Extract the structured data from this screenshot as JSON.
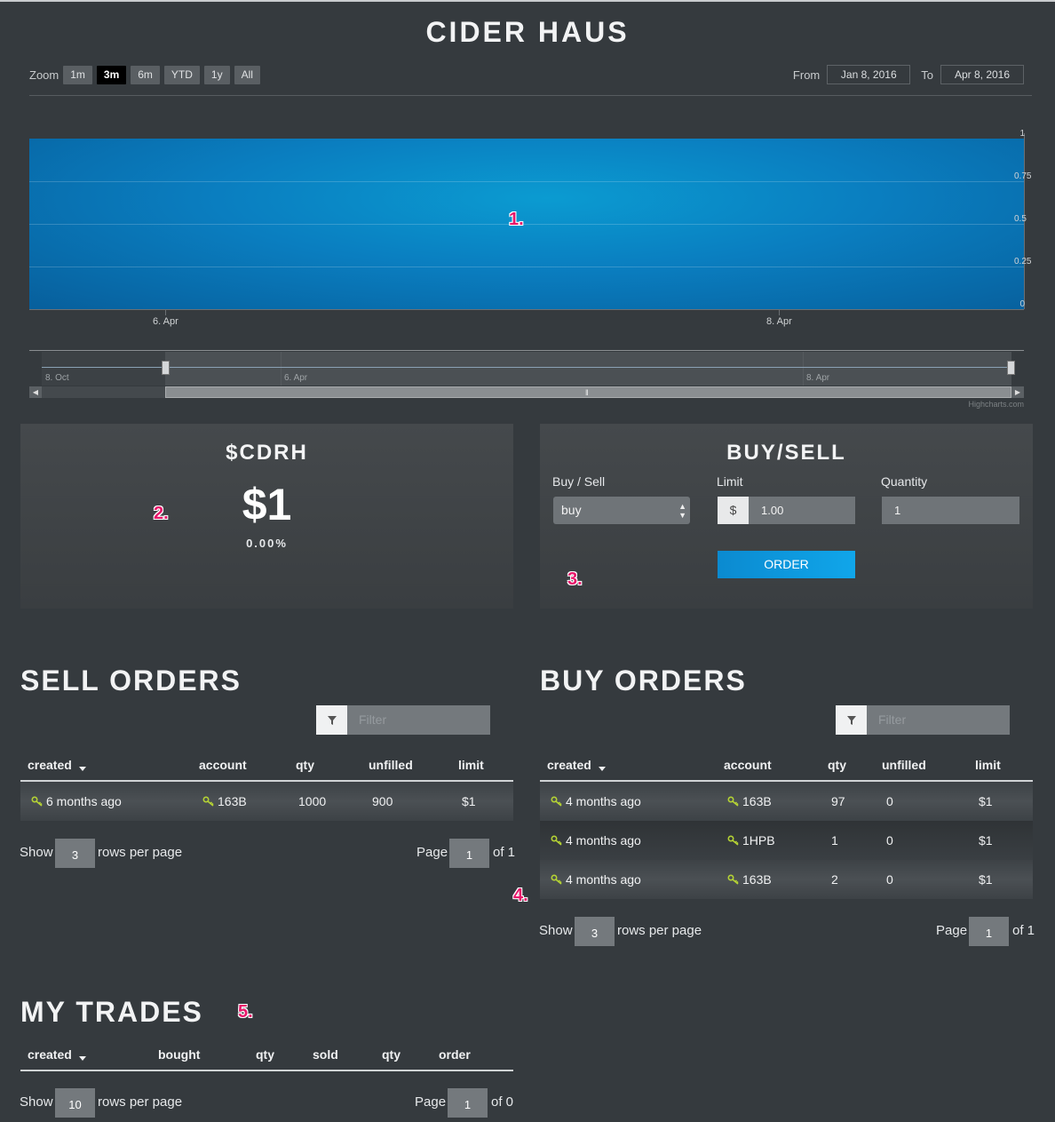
{
  "app": {
    "title": "CIDER HAUS"
  },
  "toolbar": {
    "zoom_label": "Zoom",
    "zoom_buttons": [
      "1m",
      "3m",
      "6m",
      "YTD",
      "1y",
      "All"
    ],
    "active_zoom": "3m",
    "from_label": "From",
    "from_value": "Jan 8, 2016",
    "to_label": "To",
    "to_value": "Apr 8, 2016"
  },
  "chart_data": {
    "type": "area",
    "x_tick_labels": [
      "6. Apr",
      "8. Apr"
    ],
    "y_tick_labels": [
      "1",
      "0.75",
      "0.5",
      "0.25",
      "0"
    ],
    "ylim": [
      0,
      1
    ],
    "series": [
      {
        "x": [
          "6. Apr",
          "8. Apr"
        ],
        "values": [
          1,
          1
        ]
      }
    ],
    "grid": true,
    "series_color": "#0a85c6",
    "navigator_labels": [
      "8. Oct",
      "6. Apr",
      "8. Apr"
    ],
    "credits": "Highcharts.com"
  },
  "markers": [
    "1.",
    "2.",
    "3.",
    "4.",
    "5."
  ],
  "ticker": {
    "symbol": "$CDRH",
    "price": "$1",
    "change": "0.00%"
  },
  "buysell": {
    "title": "BUY/SELL",
    "side_label": "Buy / Sell",
    "side_value": "buy",
    "limit_label": "Limit",
    "limit_addon": "$",
    "limit_value": "1.00",
    "quantity_label": "Quantity",
    "quantity_value": "1",
    "order_button": "ORDER"
  },
  "sell_orders": {
    "title": "SELL ORDERS",
    "filter_placeholder": "Filter",
    "columns": [
      "created",
      "account",
      "qty",
      "unfilled",
      "limit"
    ],
    "rows": [
      {
        "created": "6 months ago",
        "account": "163B",
        "qty": "1000",
        "unfilled": "900",
        "limit": "$1"
      }
    ],
    "show_label": "Show",
    "rows_per_page": "3",
    "rows_per_page_label": "rows per page",
    "page_label": "Page",
    "page": "1",
    "of_pages": "of 1"
  },
  "buy_orders": {
    "title": "BUY ORDERS",
    "filter_placeholder": "Filter",
    "columns": [
      "created",
      "account",
      "qty",
      "unfilled",
      "limit"
    ],
    "rows": [
      {
        "created": "4 months ago",
        "account": "163B",
        "qty": "97",
        "unfilled": "0",
        "limit": "$1"
      },
      {
        "created": "4 months ago",
        "account": "1HPB",
        "qty": "1",
        "unfilled": "0",
        "limit": "$1"
      },
      {
        "created": "4 months ago",
        "account": "163B",
        "qty": "2",
        "unfilled": "0",
        "limit": "$1"
      }
    ],
    "show_label": "Show",
    "rows_per_page": "3",
    "rows_per_page_label": "rows per page",
    "page_label": "Page",
    "page": "1",
    "of_pages": "of 1"
  },
  "my_trades": {
    "title": "MY TRADES",
    "columns": [
      "created",
      "bought",
      "qty",
      "sold",
      "qty",
      "order"
    ],
    "show_label": "Show",
    "rows_per_page": "10",
    "rows_per_page_label": "rows per page",
    "page_label": "Page",
    "page": "1",
    "of_pages": "of 0"
  },
  "colors": {
    "accent": "#0aa0e6",
    "background": "#353a3e",
    "key_icon": "#b5d334",
    "marker": "#e8176a"
  },
  "icons": {
    "filter": "filter-icon",
    "key": "key-icon",
    "sort": "sort-down-icon"
  }
}
